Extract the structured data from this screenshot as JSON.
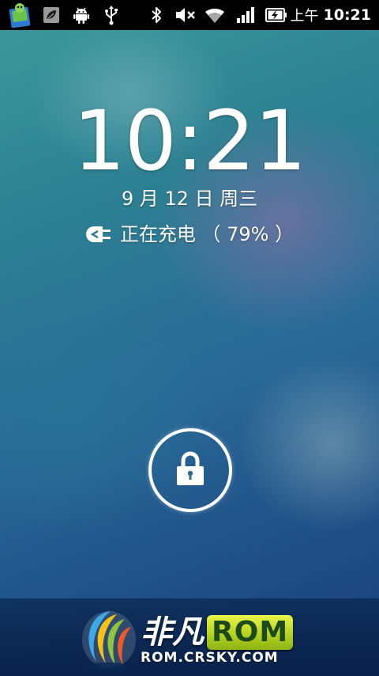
{
  "status_bar": {
    "ampm": "上午",
    "time": "10:21",
    "icons": [
      "app-store-icon",
      "leaf-icon",
      "android-icon",
      "usb-icon",
      "bluetooth-icon",
      "volume-muted-icon",
      "wifi-icon",
      "signal-icon",
      "battery-charging-icon"
    ]
  },
  "lockscreen": {
    "time": "10:21",
    "date": "9 月 12 日 周三",
    "charging_status": "正在充电 （ 79% ）",
    "battery_level_percent": 79,
    "unlock_icon": "lock-icon"
  },
  "watermark": {
    "brand_cn": "非凡",
    "brand_rom": "ROM",
    "url": "ROM.CRSKY.COM"
  }
}
